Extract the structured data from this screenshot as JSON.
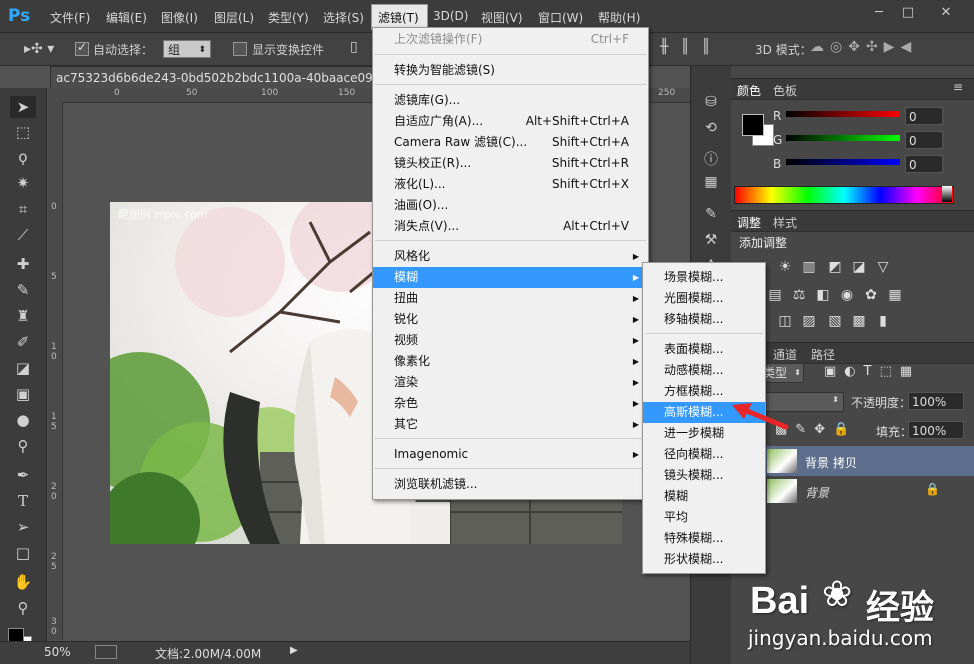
{
  "app": {
    "logo": "Ps"
  },
  "menubar": {
    "items": [
      "文件(F)",
      "编辑(E)",
      "图像(I)",
      "图层(L)",
      "类型(Y)",
      "选择(S)",
      "滤镜(T)",
      "3D(D)",
      "视图(V)",
      "窗口(W)",
      "帮助(H)"
    ],
    "active": "滤镜(T)"
  },
  "options": {
    "auto_select_label": "自动选择：",
    "group_value": "组",
    "show_transform_label": "显示变换控件",
    "mode_3d_label": "3D 模式："
  },
  "document": {
    "tab_title": "ac75323d6b6de243-0bd502b2bdc1100a-40baace09c245...",
    "photo_watermark": "昵图网 nipic.com"
  },
  "ruler": {
    "top_ticks": [
      "0",
      "50",
      "100",
      "150",
      "200",
      "250"
    ],
    "left_ticks": [
      "0",
      "5",
      "1 0",
      "1 5",
      "2 0",
      "2 5",
      "3 0"
    ]
  },
  "status": {
    "zoom": "50%",
    "doc_info": "文档:2.00M/4.00M"
  },
  "filter_menu": {
    "items": [
      {
        "label": "上次滤镜操作(F)",
        "shortcut": "Ctrl+F",
        "disabled": true
      },
      {
        "sep": true
      },
      {
        "label": "转换为智能滤镜(S)"
      },
      {
        "sep": true
      },
      {
        "label": "滤镜库(G)..."
      },
      {
        "label": "自适应广角(A)...",
        "shortcut": "Alt+Shift+Ctrl+A"
      },
      {
        "label": "Camera Raw 滤镜(C)...",
        "shortcut": "Shift+Ctrl+A"
      },
      {
        "label": "镜头校正(R)...",
        "shortcut": "Shift+Ctrl+R"
      },
      {
        "label": "液化(L)...",
        "shortcut": "Shift+Ctrl+X"
      },
      {
        "label": "油画(O)..."
      },
      {
        "label": "消失点(V)...",
        "shortcut": "Alt+Ctrl+V"
      },
      {
        "sep": true
      },
      {
        "label": "风格化",
        "submenu": true
      },
      {
        "label": "模糊",
        "submenu": true,
        "highlighted": true
      },
      {
        "label": "扭曲",
        "submenu": true
      },
      {
        "label": "锐化",
        "submenu": true
      },
      {
        "label": "视频",
        "submenu": true
      },
      {
        "label": "像素化",
        "submenu": true
      },
      {
        "label": "渲染",
        "submenu": true
      },
      {
        "label": "杂色",
        "submenu": true
      },
      {
        "label": "其它",
        "submenu": true
      },
      {
        "sep": true
      },
      {
        "label": "Imagenomic",
        "submenu": true
      },
      {
        "sep": true
      },
      {
        "label": "浏览联机滤镜..."
      }
    ]
  },
  "blur_menu": {
    "items": [
      {
        "label": "场景模糊..."
      },
      {
        "label": "光圈模糊..."
      },
      {
        "label": "移轴模糊..."
      },
      {
        "sep": true
      },
      {
        "label": "表面模糊..."
      },
      {
        "label": "动感模糊..."
      },
      {
        "label": "方框模糊..."
      },
      {
        "label": "高斯模糊...",
        "highlighted": true
      },
      {
        "label": "进一步模糊"
      },
      {
        "label": "径向模糊..."
      },
      {
        "label": "镜头模糊..."
      },
      {
        "label": "模糊"
      },
      {
        "label": "平均"
      },
      {
        "label": "特殊模糊..."
      },
      {
        "label": "形状模糊..."
      }
    ]
  },
  "color_panel": {
    "tabs": [
      "颜色",
      "色板"
    ],
    "channels": [
      {
        "label": "R",
        "value": "0",
        "color": "#ff0000"
      },
      {
        "label": "G",
        "value": "0",
        "color": "#00ff00"
      },
      {
        "label": "B",
        "value": "0",
        "color": "#0000ff"
      }
    ]
  },
  "adjustments_panel": {
    "tabs": [
      "调整",
      "样式"
    ],
    "title": "添加调整"
  },
  "layers_panel": {
    "tabs": [
      "通道",
      "路径"
    ],
    "kind_label": "类型",
    "opacity_label": "不透明度：",
    "opacity_value": "100%",
    "fill_label": "填充：",
    "fill_value": "100%",
    "layers": [
      {
        "name": "背景 拷贝",
        "selected": true
      },
      {
        "name": "背景",
        "locked": true
      }
    ]
  },
  "site_watermark": {
    "brand": "Bai",
    "brand2": "经验",
    "url": "jingyan.baidu.com"
  }
}
